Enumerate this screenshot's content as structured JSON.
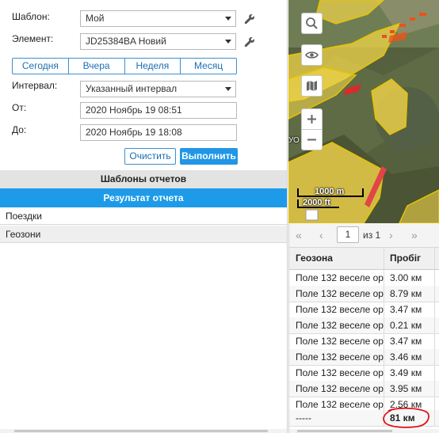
{
  "form": {
    "template_label": "Шаблон:",
    "template_value": "Мой",
    "element_label": "Элемент:",
    "element_value": "JD25384BA Новий",
    "period_tabs": [
      "Сегодня",
      "Вчера",
      "Неделя",
      "Месяц"
    ],
    "interval_label": "Интервал:",
    "interval_value": "Указанный интервал",
    "from_label": "От:",
    "from_value": "2020 Ноябрь 19 08:51",
    "to_label": "До:",
    "to_value": "2020 Ноябрь 19 18:08",
    "clear_button": "Очистить",
    "run_button": "Выполнить"
  },
  "sections": {
    "templates_header": "Шаблоны отчетов",
    "result_header": "Результат отчета",
    "result_items": [
      "Поездки",
      "Геозони"
    ]
  },
  "map": {
    "scale_metric": "1000 m",
    "scale_imperial": "2000 ft",
    "edge_label": "УО"
  },
  "table": {
    "pager": {
      "page": "1",
      "of_label": "из 1"
    },
    "columns": [
      "Геозона",
      "Пробіг"
    ],
    "rows": [
      [
        "Поле 132 веселе ор",
        "3.00 км"
      ],
      [
        "Поле 132 веселе ор",
        "8.79 км"
      ],
      [
        "Поле 132 веселе ор",
        "3.47 км"
      ],
      [
        "Поле 132 веселе ор",
        "0.21 км"
      ],
      [
        "Поле 132 веселе ор",
        "3.47 км"
      ],
      [
        "Поле 132 веселе ор",
        "3.46 км"
      ],
      [
        "Поле 132 веселе ор",
        "3.49 км"
      ],
      [
        "Поле 132 веселе ор",
        "3.95 км"
      ],
      [
        "Поле 132 веселе ор",
        "2.56 км"
      ]
    ],
    "total": [
      "-----",
      "81 км"
    ]
  },
  "colors": {
    "accent": "#1e9be8",
    "field_fill": "#f2d54a",
    "annotation": "#e0141e"
  },
  "icons": [
    "wrench-icon",
    "search-icon",
    "eye-icon",
    "map-layers-icon",
    "zoom-in-icon",
    "zoom-out-icon"
  ]
}
